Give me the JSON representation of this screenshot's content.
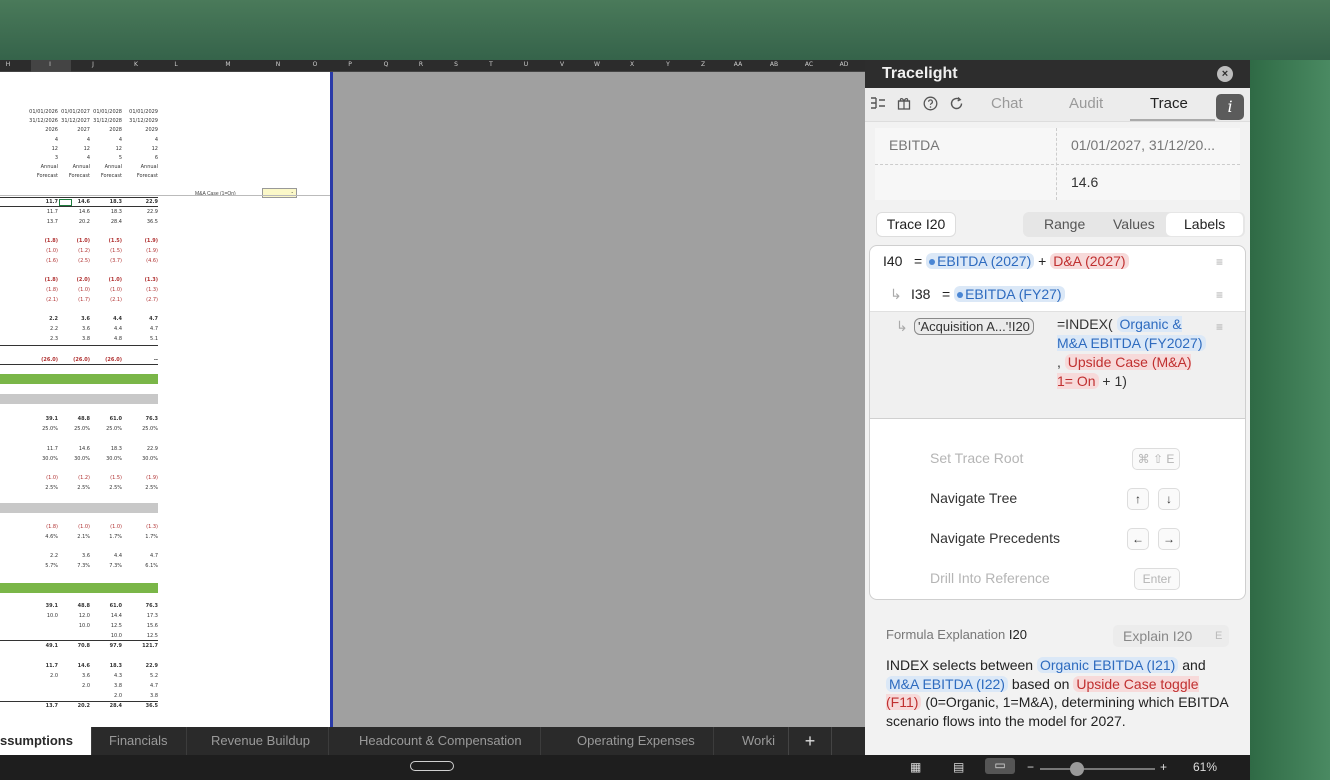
{
  "sheet": {
    "columns": [
      "H",
      "I",
      "J",
      "K",
      "L",
      "M",
      "N",
      "O",
      "P",
      "Q",
      "R",
      "S",
      "T",
      "U",
      "V",
      "W",
      "X",
      "Y",
      "Z",
      "AA",
      "AB",
      "AC",
      "AD"
    ],
    "header_rows": [
      [
        "01/01/2026",
        "01/01/2027",
        "01/01/2028",
        "01/01/2029"
      ],
      [
        "31/12/2026",
        "31/12/2027",
        "31/12/2028",
        "31/12/2029"
      ],
      [
        "2026",
        "2027",
        "2028",
        "2029"
      ],
      [
        "4",
        "4",
        "4",
        "4"
      ],
      [
        "12",
        "12",
        "12",
        "12"
      ],
      [
        "3",
        "4",
        "5",
        "6"
      ],
      [
        "Annual",
        "Annual",
        "Annual",
        "Annual"
      ],
      [
        "Forecast",
        "Forecast",
        "Forecast",
        "Forecast"
      ]
    ],
    "mna_label": "M&A Case (1=On)",
    "mna_value": "-",
    "data_rows": [
      [
        "11.7",
        "14.6",
        "18.3",
        "22.9"
      ],
      [
        "11.7",
        "14.6",
        "18.3",
        "22.9"
      ],
      [
        "13.7",
        "20.2",
        "28.4",
        "36.5"
      ],
      [
        "(1.8)",
        "(1.0)",
        "(1.5)",
        "(1.9)"
      ],
      [
        "(1.0)",
        "(1.2)",
        "(1.5)",
        "(1.9)"
      ],
      [
        "(1.6)",
        "(2.5)",
        "(3.7)",
        "(4.6)"
      ],
      [
        "(1.8)",
        "(2.0)",
        "(1.0)",
        "(1.3)"
      ],
      [
        "(1.8)",
        "(1.0)",
        "(1.0)",
        "(1.3)"
      ],
      [
        "(2.1)",
        "(1.7)",
        "(2.1)",
        "(2.7)"
      ],
      [
        "2.2",
        "3.6",
        "4.4",
        "4.7"
      ],
      [
        "2.2",
        "3.6",
        "4.4",
        "4.7"
      ],
      [
        "2.3",
        "3.8",
        "4.8",
        "5.1"
      ],
      [
        "(26.0)",
        "(26.0)",
        "(26.0)",
        "--"
      ],
      [
        "39.1",
        "48.8",
        "61.0",
        "76.3"
      ],
      [
        "25.0%",
        "25.0%",
        "25.0%",
        "25.0%"
      ],
      [
        "11.7",
        "14.6",
        "18.3",
        "22.9"
      ],
      [
        "30.0%",
        "30.0%",
        "30.0%",
        "30.0%"
      ],
      [
        "(1.0)",
        "(1.2)",
        "(1.5)",
        "(1.9)"
      ],
      [
        "2.5%",
        "2.5%",
        "2.5%",
        "2.5%"
      ],
      [
        "(1.8)",
        "(1.0)",
        "(1.0)",
        "(1.3)"
      ],
      [
        "4.6%",
        "2.1%",
        "1.7%",
        "1.7%"
      ],
      [
        "2.2",
        "3.6",
        "4.4",
        "4.7"
      ],
      [
        "5.7%",
        "7.3%",
        "7.3%",
        "6.1%"
      ],
      [
        "39.1",
        "48.8",
        "61.0",
        "76.3"
      ],
      [
        "10.0",
        "12.0",
        "14.4",
        "17.3"
      ],
      [
        "",
        "10.0",
        "12.5",
        "15.6"
      ],
      [
        "",
        "",
        "10.0",
        "12.5"
      ],
      [
        "49.1",
        "70.8",
        "97.9",
        "121.7"
      ],
      [
        "11.7",
        "14.6",
        "18.3",
        "22.9"
      ],
      [
        "2.0",
        "3.6",
        "4.3",
        "5.2"
      ],
      [
        "",
        "2.0",
        "3.8",
        "4.7"
      ],
      [
        "",
        "",
        "2.0",
        "3.8"
      ],
      [
        "13.7",
        "20.2",
        "28.4",
        "36.5"
      ]
    ],
    "tabs": [
      "ssumptions",
      "Financials",
      "Revenue Buildup",
      "Headcount & Compensation",
      "Operating Expenses",
      "Worki"
    ],
    "add_tab": "+"
  },
  "panel": {
    "title": "Tracelight",
    "close": "×",
    "toolbar_icons": [
      "tree-icon",
      "gift-icon",
      "help-icon",
      "refresh-icon"
    ],
    "tabs": {
      "chat": "Chat",
      "audit": "Audit",
      "trace": "Trace"
    },
    "info": "i",
    "kv": {
      "key": "EBITDA",
      "period": "01/01/2027, 31/12/20...",
      "value": "14.6"
    },
    "trace_button": "Trace I20",
    "view_modes": {
      "range": "Range",
      "values": "Values",
      "labels": "Labels"
    },
    "tree": {
      "row1": {
        "cell": "I40",
        "eq": "=",
        "a": "EBITDA (2027)",
        "plus": "+",
        "b": "D&A (2027)"
      },
      "row2": {
        "cell": "I38",
        "eq": "=",
        "a": "EBITDA (FY27)"
      },
      "row3": {
        "ref": "'Acquisition A...'!I20",
        "f1": "=INDEX(",
        "f2": "Organic & M&A EBITDA (FY2027)",
        "f3": ",",
        "f4": "Upside Case (M&A) 1= On",
        "f5": "+ 1)"
      }
    },
    "shortcuts": [
      {
        "label": "Set Trace Root",
        "keys": [
          "⌘ ⇧ E"
        ],
        "dim": true
      },
      {
        "label": "Navigate Tree",
        "keys": [
          "↑",
          "↓"
        ],
        "dim": false
      },
      {
        "label": "Navigate Precedents",
        "keys": [
          "←",
          "→"
        ],
        "dim": false
      },
      {
        "label": "Drill Into Reference",
        "keys": [
          "Enter"
        ],
        "dim": true
      }
    ],
    "explanation": {
      "title": "Formula Explanation",
      "cell": "I20",
      "button": "Explain I20",
      "button_key": "E",
      "t1": "INDEX selects between",
      "p1": "Organic EBITDA (I21)",
      "t2": "and",
      "p2": "M&A EBITDA (I22)",
      "t3": "based on",
      "p3": "Upside Case toggle (F11)",
      "t4": "(0=Organic, 1=M&A), determining which EBITDA scenario flows into the model for 2027."
    }
  },
  "status": {
    "zoom": "61%"
  }
}
